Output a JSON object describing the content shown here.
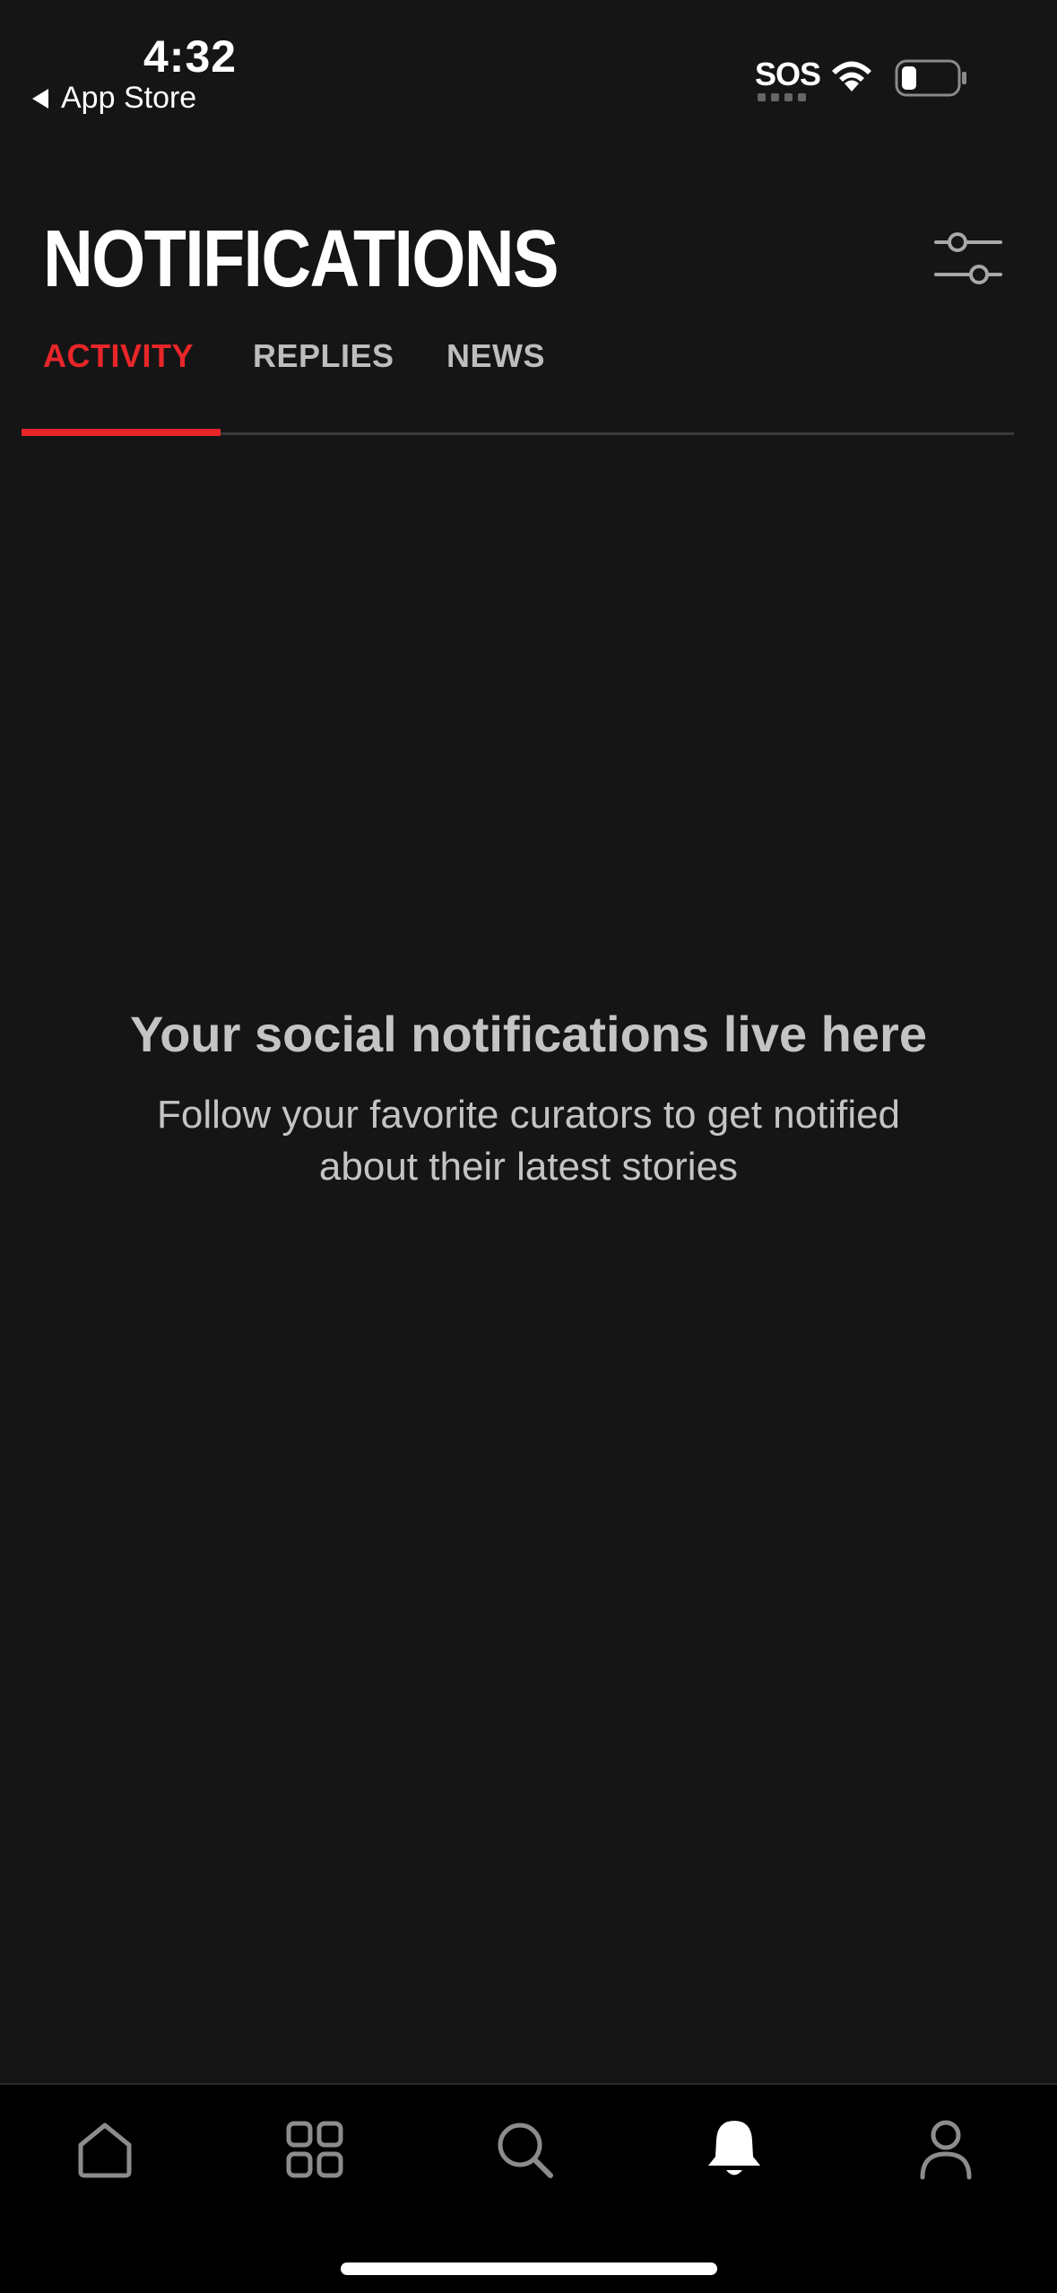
{
  "status_bar": {
    "time": "4:32",
    "back_label": "App Store",
    "sos": "SOS"
  },
  "header": {
    "title": "NOTIFICATIONS",
    "filter_icon": "sliders-icon"
  },
  "tabs": [
    {
      "label": "ACTIVITY",
      "active": true
    },
    {
      "label": "REPLIES",
      "active": false
    },
    {
      "label": "NEWS",
      "active": false
    }
  ],
  "empty_state": {
    "title": "Your social notifications live here",
    "body": "Follow your favorite curators to get notified about their latest stories"
  },
  "bottom_nav": [
    {
      "name": "home",
      "icon": "home-icon"
    },
    {
      "name": "categories",
      "icon": "grid-icon"
    },
    {
      "name": "search",
      "icon": "search-icon"
    },
    {
      "name": "notifications",
      "icon": "bell-icon",
      "active": true
    },
    {
      "name": "profile",
      "icon": "person-icon"
    }
  ],
  "colors": {
    "background": "#151515",
    "accent": "#e8262a",
    "nav_background": "#000000"
  }
}
